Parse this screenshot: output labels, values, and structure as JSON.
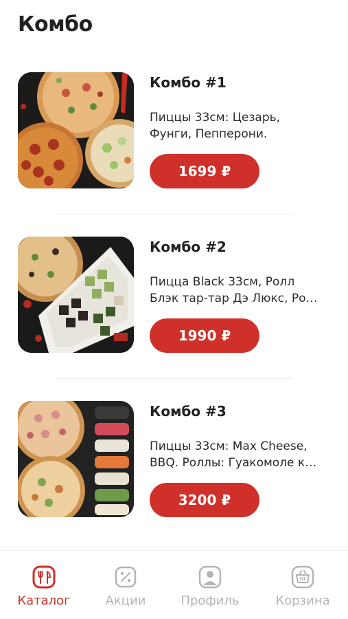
{
  "header": {
    "title": "Комбо"
  },
  "combos": [
    {
      "title": "Комбо #1",
      "desc_lines": [
        "Пиццы 33см: Цезарь,",
        "Фунги, Пепперони."
      ],
      "price": "1699 ₽"
    },
    {
      "title": "Комбо #2",
      "desc_lines": [
        "Пицца Black 33см, Ролл",
        "Блэк тар-тар Дэ Люкс, Ро…"
      ],
      "price": "1990 ₽"
    },
    {
      "title": "Комбо #3",
      "desc_lines": [
        "Пиццы 33см: Max Cheese,",
        "BBQ.   Роллы: Гуакомоле к…"
      ],
      "price": "3200 ₽"
    }
  ],
  "tabbar": {
    "active": "catalog",
    "tabs": [
      {
        "key": "catalog",
        "label": "Каталог",
        "icon": "catalog-icon"
      },
      {
        "key": "promos",
        "label": "Акции",
        "icon": "percent-icon"
      },
      {
        "key": "profile",
        "label": "Профиль",
        "icon": "profile-icon"
      },
      {
        "key": "cart",
        "label": "Корзина",
        "icon": "basket-icon"
      }
    ]
  },
  "colors": {
    "accent": "#d0302a",
    "inactive": "#b4b4b4",
    "text": "#222222"
  }
}
